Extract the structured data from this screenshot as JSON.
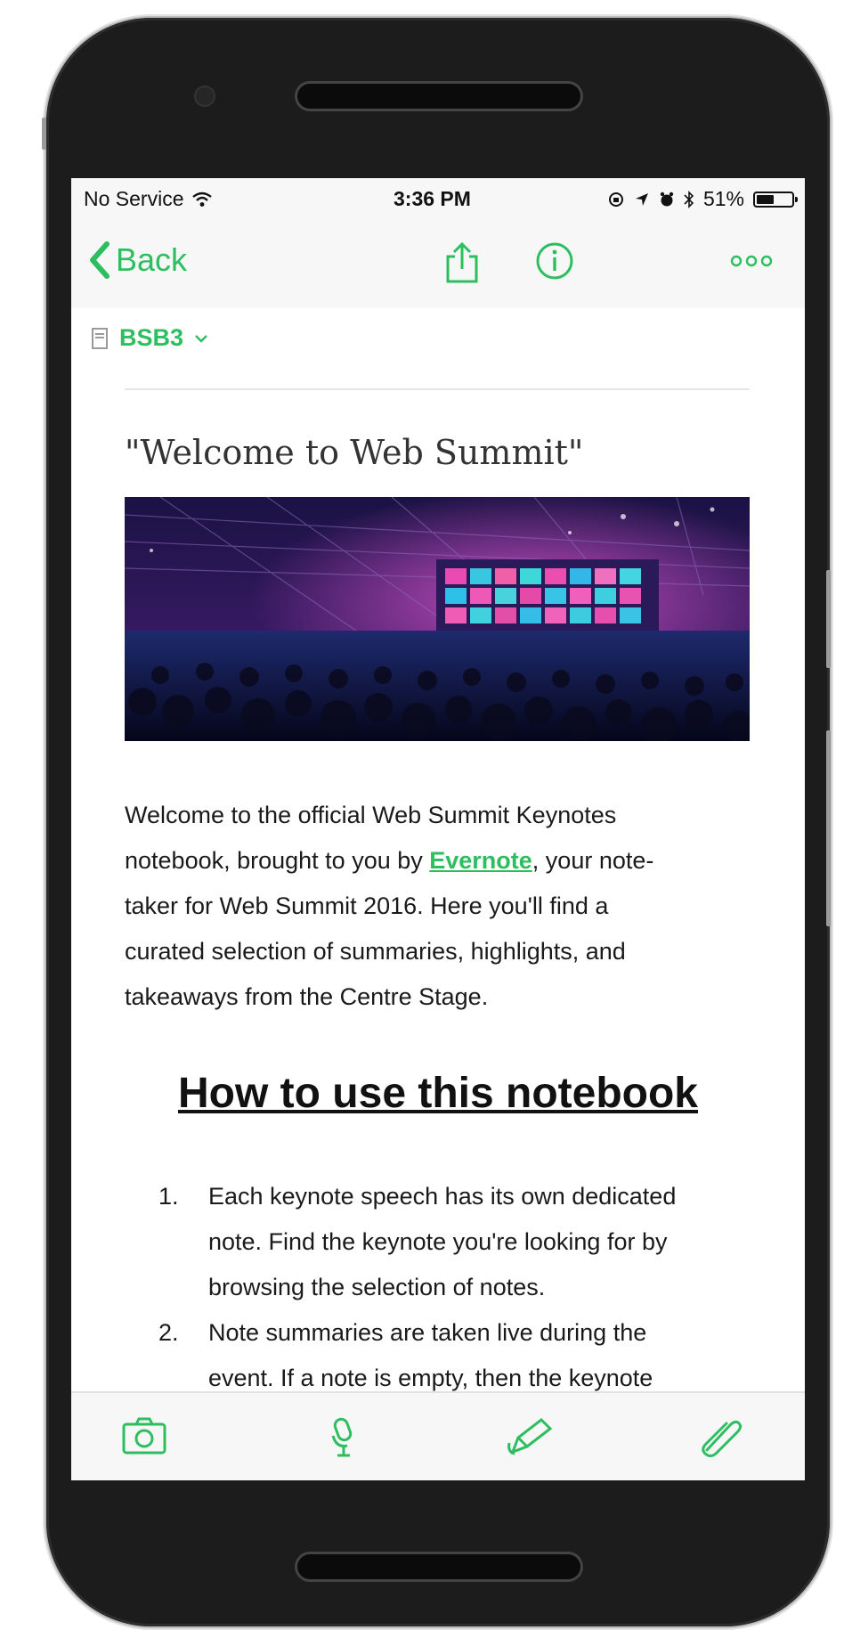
{
  "status_bar": {
    "carrier": "No Service",
    "time": "3:36 PM",
    "battery": "51%",
    "battery_level": 0.51
  },
  "nav": {
    "back_label": "Back",
    "icons": [
      "share-icon",
      "info-icon",
      "more-icon"
    ]
  },
  "notebook": {
    "name": "BSB3"
  },
  "note": {
    "title": "\"Welcome to Web Summit\"",
    "intro_lines": [
      "Welcome to the official Web Summit Keynotes",
      "notebook, brought to you by ",
      "Evernote",
      ", your note-",
      "taker for Web Summit 2016. Here you'll find a",
      "curated selection of summaries, highlights, and",
      "takeaways from the Centre Stage."
    ],
    "how_heading": "How to use this notebook",
    "steps": [
      {
        "num": "1.",
        "lines": [
          "Each keynote speech has its own dedicated",
          "note. Find the keynote you're looking for by",
          "browsing the selection of notes."
        ]
      },
      {
        "num": "2.",
        "lines": [
          "Note summaries are taken live during the",
          "event. If a note is empty, then the keynote"
        ]
      }
    ]
  },
  "toolbar": {
    "icons": [
      "camera-icon",
      "microphone-icon",
      "pen-icon",
      "paperclip-icon"
    ]
  },
  "colors": {
    "accent": "#2dbe60",
    "text": "#1a1a1a",
    "bar_background": "#f7f7f7"
  }
}
